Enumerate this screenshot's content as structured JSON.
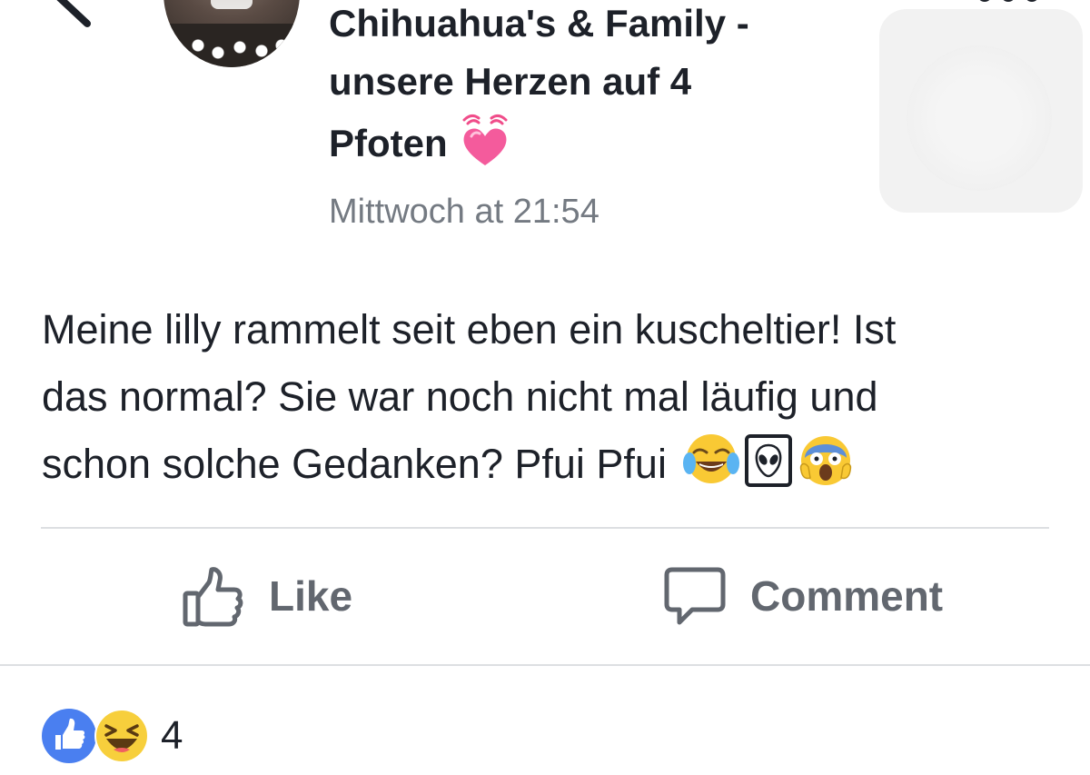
{
  "header": {
    "group_name_lines": [
      "Chihuahua's & Family -",
      "unsere Herzen auf 4",
      "Pfoten"
    ],
    "title_emoji": "beating-heart-icon",
    "timestamp": "Mittwoch at 21:54"
  },
  "post": {
    "text_lines": [
      "Meine lilly rammelt seit eben ein kuscheltier! Ist",
      "das normal? Sie war noch nicht mal läufig und",
      "schon solche Gedanken? Pfui Pfui"
    ],
    "emojis": [
      "tears-of-joy-icon",
      "alien-icon",
      "screaming-face-icon"
    ]
  },
  "actions": {
    "like_label": "Like",
    "comment_label": "Comment"
  },
  "reactions": {
    "icons": [
      "like-reaction-icon",
      "haha-reaction-icon"
    ],
    "count": "4"
  },
  "colors": {
    "text": "#1d2129",
    "secondary": "#747a82",
    "action": "#62676f",
    "divider": "#dddfe2",
    "like_blue": "#4a7ff0",
    "haha_yellow": "#f7cf3c"
  }
}
